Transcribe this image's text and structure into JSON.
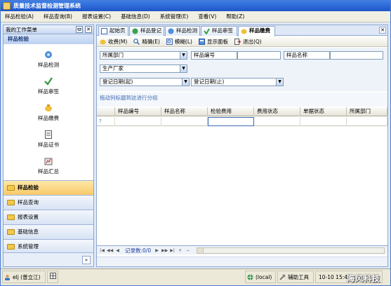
{
  "app": {
    "title": "质量技术监督检测管理系统"
  },
  "menu": [
    "样品检验(A)",
    "样品查询(B)",
    "报表设置(C)",
    "基础信息(D)",
    "系统管理(E)",
    "查看(V)",
    "帮助(Z)"
  ],
  "left_panel": {
    "header": "我的工作菜单",
    "pin_label": "ϖ",
    "close_label": "✕",
    "group_title": "样品检验",
    "modules": [
      "样品检测",
      "样品审签",
      "样品缴费",
      "样品证书",
      "样品汇总"
    ],
    "nav_sections": [
      "样品检验",
      "样品查询",
      "报表设置",
      "基础信息",
      "系统管理"
    ],
    "active_section": "样品检验",
    "collapse_glyph": "»"
  },
  "tabs": [
    "起始页",
    "样品登记",
    "样品检测",
    "样品审签",
    "样品缴费"
  ],
  "active_tab": "样品缴费",
  "tab_close_label": "✕",
  "toolbar": [
    "收费(M)",
    "精确(E)",
    "模糊(L)",
    "显示面板",
    "退出(Q)"
  ],
  "form": {
    "dept": "所属部门",
    "sample_no": "样品编号",
    "sample_name": "样品名称",
    "manufacturer": "生产厂家",
    "reg_date_from": "登记日期(起)",
    "reg_date_to": "登记日期(止)"
  },
  "group_hint": "拖动列标题到这进行分组",
  "grid": {
    "columns": [
      "样品编号",
      "样品名称",
      "检验费用",
      "费用状态",
      "单据状态",
      "所属部门"
    ],
    "filter_marker": "?"
  },
  "pager": {
    "text": "记录数:0/0",
    "buttons": [
      "|◀",
      "◀◀",
      "◀",
      "▶",
      "▶▶",
      "▶|",
      "+",
      "−"
    ]
  },
  "status": {
    "user": "elj (普立江)",
    "db": "(local)",
    "tools": "辅助工具",
    "date": "10-10 15:47",
    "watermark": "海风科技"
  },
  "colors": {
    "accent": "#1e55c8",
    "panel_border": "#8fa7cf",
    "active_nav": "#f9c96a"
  }
}
